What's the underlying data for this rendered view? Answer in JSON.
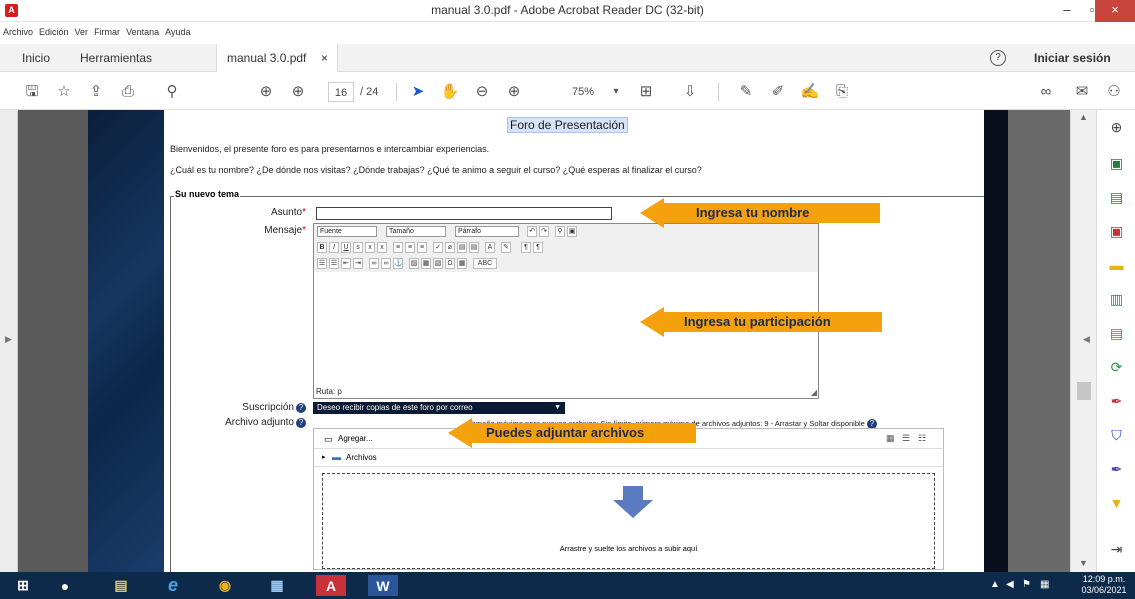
{
  "window": {
    "title": "manual 3.0.pdf - Adobe Acrobat Reader DC (32-bit)",
    "app_icon": "A"
  },
  "menu": [
    "Archivo",
    "Edición",
    "Ver",
    "Firmar",
    "Ventana",
    "Ayuda"
  ],
  "tabs": {
    "home": "Inicio",
    "tools": "Herramientas",
    "document": "manual 3.0.pdf",
    "close": "×",
    "help": "?",
    "signin": "Iniciar sesión"
  },
  "toolbar": {
    "page_current": "16",
    "page_total": "/ 24",
    "zoom": "75%"
  },
  "page": {
    "heading": "Foro de Presentación",
    "intro": "Bienvenidos, el presente foro es para presentarnos e intercambiar experiencias.",
    "questions": "¿Cuál es tu nombre? ¿De dónde nos visitas? ¿Dónde trabajas? ¿Qué te animo a seguir el curso? ¿Qué esperas al finalizar el curso?",
    "fieldset_legend": "Su nuevo tema",
    "subject_label": "Asunto",
    "message_label": "Mensaje",
    "required_mark": "*",
    "editor": {
      "font": "Fuente",
      "size": "Tamaño",
      "paragraph": "Párrafo",
      "path": "Ruta: p"
    },
    "subscription_label": "Suscripción",
    "subscription_value": "Deseo recibir copias de este foro por correo",
    "attachment_label": "Archivo adjunto",
    "max_info": "Tamaño máximo para nuevos archivos: Sin límite, número máximo de archivos adjuntos: 9 - Arrastar y Soltar disponible",
    "add_label": "Agregar...",
    "files_label": "Archivos",
    "drop_text": "Arrastre y suelte los archivos a subir aquí"
  },
  "callouts": {
    "name": "Ingresa tu nombre",
    "participation": "Ingresa tu participación",
    "attach": "Puedes adjuntar archivos",
    "color": "#f5a10d"
  },
  "taskbar": {
    "time": "12:09 p.m.",
    "date": "03/06/2021"
  }
}
